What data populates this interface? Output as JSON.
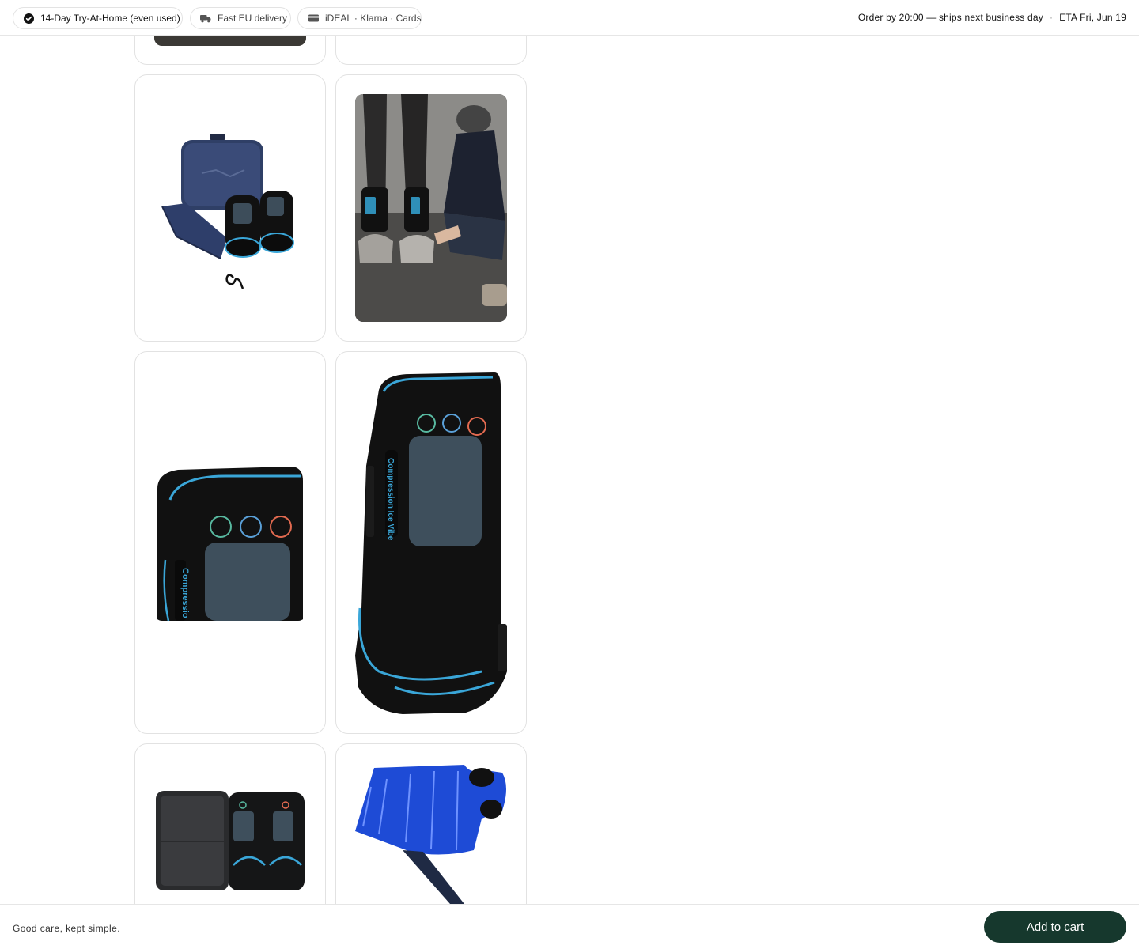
{
  "topbar": {
    "badges": [
      {
        "label": "14-Day Try-At-Home (even used)",
        "icon": "check-circle-icon"
      },
      {
        "label": "Fast EU delivery",
        "icon": "truck-icon"
      },
      {
        "label": "iDEAL · Klarna · Cards",
        "icon": "card-icon"
      }
    ],
    "shipping": "Order by 20:00 — ships next business day",
    "eta": "ETA Fri, Jun 19"
  },
  "gallery": {
    "images": [
      {
        "subject": "horse-leg-photo"
      },
      {
        "subject": "empty"
      },
      {
        "subject": "kit-with-carry-case"
      },
      {
        "subject": "rider-fitting-boots-on-horse"
      },
      {
        "subject": "compression-boot-short"
      },
      {
        "subject": "compression-boot-tall"
      },
      {
        "subject": "open-carry-case"
      },
      {
        "subject": "blue-ice-pack"
      }
    ]
  },
  "footer": {
    "tagline": "Good care, kept simple.",
    "cart_label": "Add to cart"
  },
  "colors": {
    "accent": "#16382d",
    "boot_trim": "#3aa6d8",
    "border": "#e2e2e2"
  }
}
